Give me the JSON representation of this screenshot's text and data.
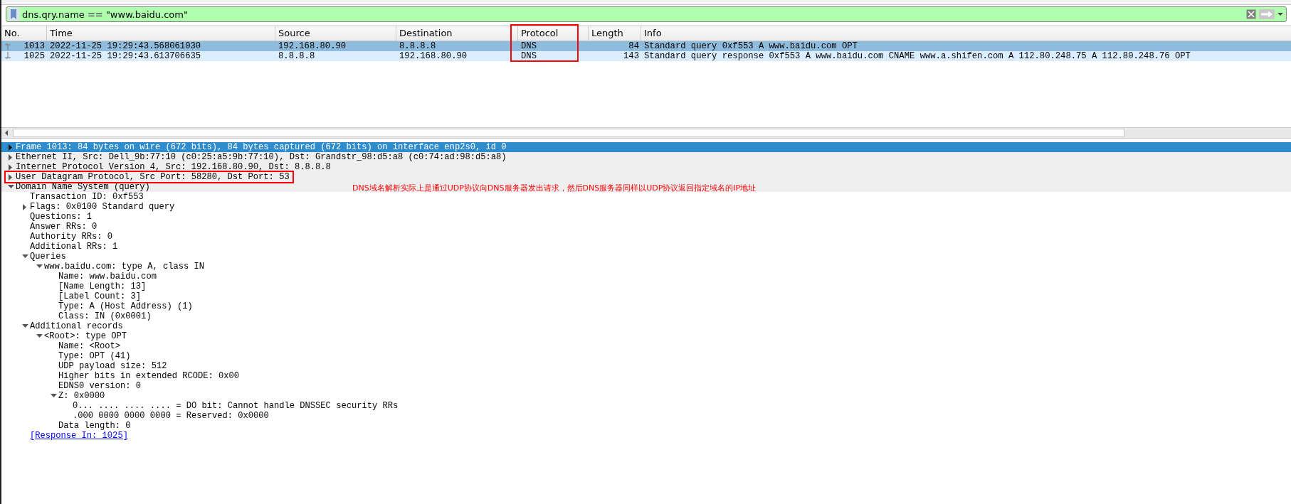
{
  "filter": {
    "value": "dns.qry.name == \"www.baidu.com\""
  },
  "packet_list": {
    "columns": [
      {
        "label": "No.",
        "highlighted": false
      },
      {
        "label": "Time",
        "highlighted": false
      },
      {
        "label": "Source",
        "highlighted": false
      },
      {
        "label": "Destination",
        "highlighted": false
      },
      {
        "label": "Protocol",
        "highlighted": true
      },
      {
        "label": "Length",
        "highlighted": false
      },
      {
        "label": "Info",
        "highlighted": false
      }
    ],
    "rows": [
      {
        "selected": true,
        "kind": "request",
        "cells": [
          "1013",
          "2022-11-25 19:29:43.568061030",
          "192.168.80.90",
          "8.8.8.8",
          "DNS",
          "84",
          "Standard query 0xf553 A www.baidu.com OPT"
        ]
      },
      {
        "selected": false,
        "kind": "response",
        "cells": [
          "1025",
          "2022-11-25 19:29:43.613706635",
          "8.8.8.8",
          "192.168.80.90",
          "DNS",
          "143",
          "Standard query response 0xf553 A www.baidu.com CNAME www.a.shifen.com A 112.80.248.75 A 112.80.248.76 OPT"
        ]
      }
    ]
  },
  "details": [
    {
      "label": "Frame 1013: 84 bytes on wire (672 bits), 84 bytes captured (672 bits) on interface enp2s0, id 0",
      "selected": true,
      "expanded": false,
      "highlighted": false
    },
    {
      "label": "Ethernet II, Src: Dell_9b:77:10 (c0:25:a5:9b:77:10), Dst: Grandstr_98:d5:a8 (c0:74:ad:98:d5:a8)",
      "selected": false,
      "expanded": false,
      "highlighted": false
    },
    {
      "label": "Internet Protocol Version 4, Src: 192.168.80.90, Dst: 8.8.8.8",
      "selected": false,
      "expanded": false,
      "highlighted": false
    },
    {
      "label": "User Datagram Protocol, Src Port: 58280, Dst Port: 53",
      "selected": false,
      "expanded": false,
      "highlighted": true
    },
    {
      "label": "Domain Name System (query)",
      "selected": false,
      "expanded": true,
      "highlighted": false,
      "children": [
        {
          "label": "Transaction ID: 0xf553",
          "selected": false
        },
        {
          "label": "Flags: 0x0100 Standard query",
          "selected": false,
          "expanded": false
        },
        {
          "label": "Questions: 1",
          "selected": false
        },
        {
          "label": "Answer RRs: 0",
          "selected": false
        },
        {
          "label": "Authority RRs: 0",
          "selected": false
        },
        {
          "label": "Additional RRs: 1",
          "selected": false
        },
        {
          "label": "Queries",
          "selected": false,
          "expanded": true,
          "children": [
            {
              "label": "www.baidu.com: type A, class IN",
              "selected": false,
              "expanded": true,
              "children": [
                {
                  "label": "Name: www.baidu.com",
                  "selected": false
                },
                {
                  "label": "[Name Length: 13]",
                  "selected": false
                },
                {
                  "label": "[Label Count: 3]",
                  "selected": false
                },
                {
                  "label": "Type: A (Host Address) (1)",
                  "selected": false
                },
                {
                  "label": "Class: IN (0x0001)",
                  "selected": false
                }
              ]
            }
          ]
        },
        {
          "label": "Additional records",
          "selected": false,
          "expanded": true,
          "children": [
            {
              "label": "<Root>: type OPT",
              "selected": false,
              "expanded": true,
              "children": [
                {
                  "label": "Name: <Root>",
                  "selected": false
                },
                {
                  "label": "Type: OPT (41)",
                  "selected": false
                },
                {
                  "label": "UDP payload size: 512",
                  "selected": false
                },
                {
                  "label": "Higher bits in extended RCODE: 0x00",
                  "selected": false
                },
                {
                  "label": "EDNS0 version: 0",
                  "selected": false
                },
                {
                  "label": "Z: 0x0000",
                  "selected": false,
                  "expanded": true,
                  "children": [
                    {
                      "label": "0... .... .... .... = DO bit: Cannot handle DNSSEC security RRs",
                      "selected": false
                    },
                    {
                      "label": ".000 0000 0000 0000 = Reserved: 0x0000",
                      "selected": false
                    }
                  ]
                },
                {
                  "label": "Data length: 0",
                  "selected": false
                }
              ]
            }
          ]
        },
        {
          "label": "[Response In: 1025]",
          "selected": false,
          "kind": "link"
        }
      ]
    }
  ],
  "annotation": {
    "text": "DNS域名解析实际上是通过UDP协议向DNS服务器发出请求，然后DNS服务器同样以UDP协议返回指定域名的IP地址"
  }
}
